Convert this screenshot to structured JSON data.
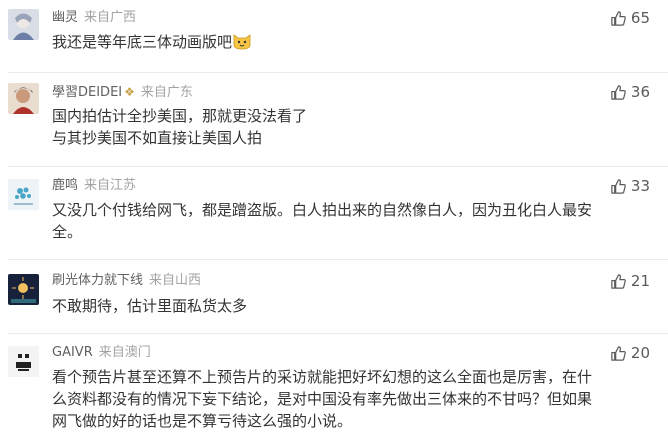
{
  "comments": [
    {
      "username": "幽灵",
      "location": "来自广西",
      "lines": [
        "我还是等年底三体动画版吧"
      ],
      "likes": "65",
      "has_emoji": true
    },
    {
      "username": "學習DEIDEI",
      "location": "来自广东",
      "lines": [
        "国内拍估计全抄美国，那就更没法看了",
        "与其抄美国不如直接让美国人拍"
      ],
      "likes": "36"
    },
    {
      "username": "鹿鸣",
      "location": "来自江苏",
      "lines": [
        "又没几个付钱给网飞，都是蹭盗版。白人拍出来的自然像白人，因为丑化白人最安",
        "全。"
      ],
      "likes": "33"
    },
    {
      "username": "刷光体力就下线",
      "location": "来自山西",
      "lines": [
        "不敢期待，估计里面私货太多"
      ],
      "likes": "21"
    },
    {
      "username": "GAIVR",
      "location": "来自澳门",
      "lines": [
        "看个预告片甚至还算不上预告片的采访就能把好坏幻想的这么全面也是厉害，在什",
        "么资料都没有的情况下妄下结论，是对中国没有率先做出三体来的不甘吗？但如果",
        "网飞做的好的话也是不算亏待这么强的小说。"
      ],
      "likes": "20"
    }
  ]
}
